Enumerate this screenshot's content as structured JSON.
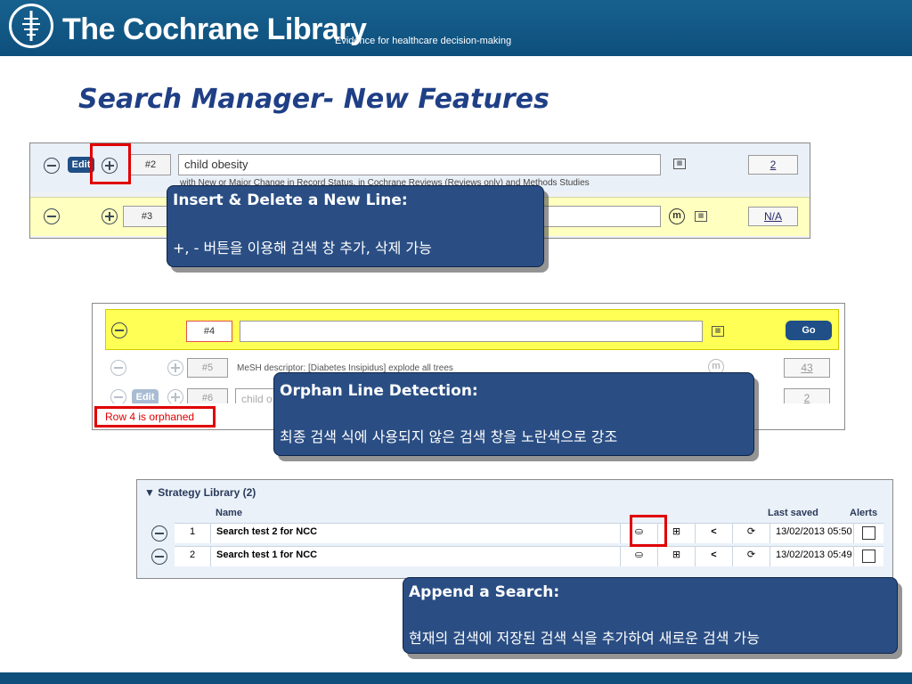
{
  "header": {
    "brand": "The Cochrane Library",
    "tagline": "Evidence for healthcare decision-making"
  },
  "slide_title": "Search Manager- New Features",
  "panel1": {
    "edit_label": "Edit",
    "row2": {
      "number": "#2",
      "query": "child obesity",
      "limit_note": "with New or Major Change in Record Status, in Cochrane Reviews (Reviews only) and Methods Studies",
      "hits": "2"
    },
    "row3": {
      "number": "#3",
      "hits": "N/A"
    }
  },
  "callout1": {
    "title": "Insert & Delete a New Line:",
    "body": "+, - 버튼을 이용해 검색 창 추가, 삭제 가능"
  },
  "panel2": {
    "row4": {
      "number": "#4",
      "go_label": "Go"
    },
    "row5": {
      "number": "#5",
      "query": "MeSH descriptor: [Diabetes Insipidus] explode all trees",
      "hits": "43"
    },
    "row6": {
      "edit_label": "Edit",
      "number": "#6",
      "query": "child o",
      "hits": "2"
    },
    "warning": "Row 4 is orphaned"
  },
  "callout2": {
    "title": "Orphan Line Detection:",
    "body": "최종 검색 식에 사용되지 않은 검색 창을 노란색으로 강조"
  },
  "strategy": {
    "header": "Strategy Library (2)",
    "columns": {
      "name": "Name",
      "last_saved": "Last saved",
      "alerts": "Alerts"
    },
    "rows": [
      {
        "num": "1",
        "name": "Search test 2 for NCC",
        "saved": "13/02/2013 05:50"
      },
      {
        "num": "2",
        "name": "Search test 1 for NCC",
        "saved": "13/02/2013 05:49"
      }
    ]
  },
  "callout3": {
    "title": "Append a Search:",
    "body": "현재의 검색에 저장된 검색 식을 추가하여 새로운 검색 가능"
  },
  "icons": {
    "logo": "cochrane-logo",
    "minus": "minus-circle-icon",
    "plus": "plus-circle-icon",
    "grid": "limits-grid-icon",
    "mesh": "mesh-m-icon",
    "run": "run-strategy-icon",
    "append": "append-search-icon",
    "share": "share-icon",
    "export": "export-icon"
  },
  "colors": {
    "banner": "#0e4f7c",
    "title": "#1f3f86",
    "callout": "#2a4e84",
    "highlight_yellow": "#ffff55",
    "red_frame": "#e00000"
  }
}
